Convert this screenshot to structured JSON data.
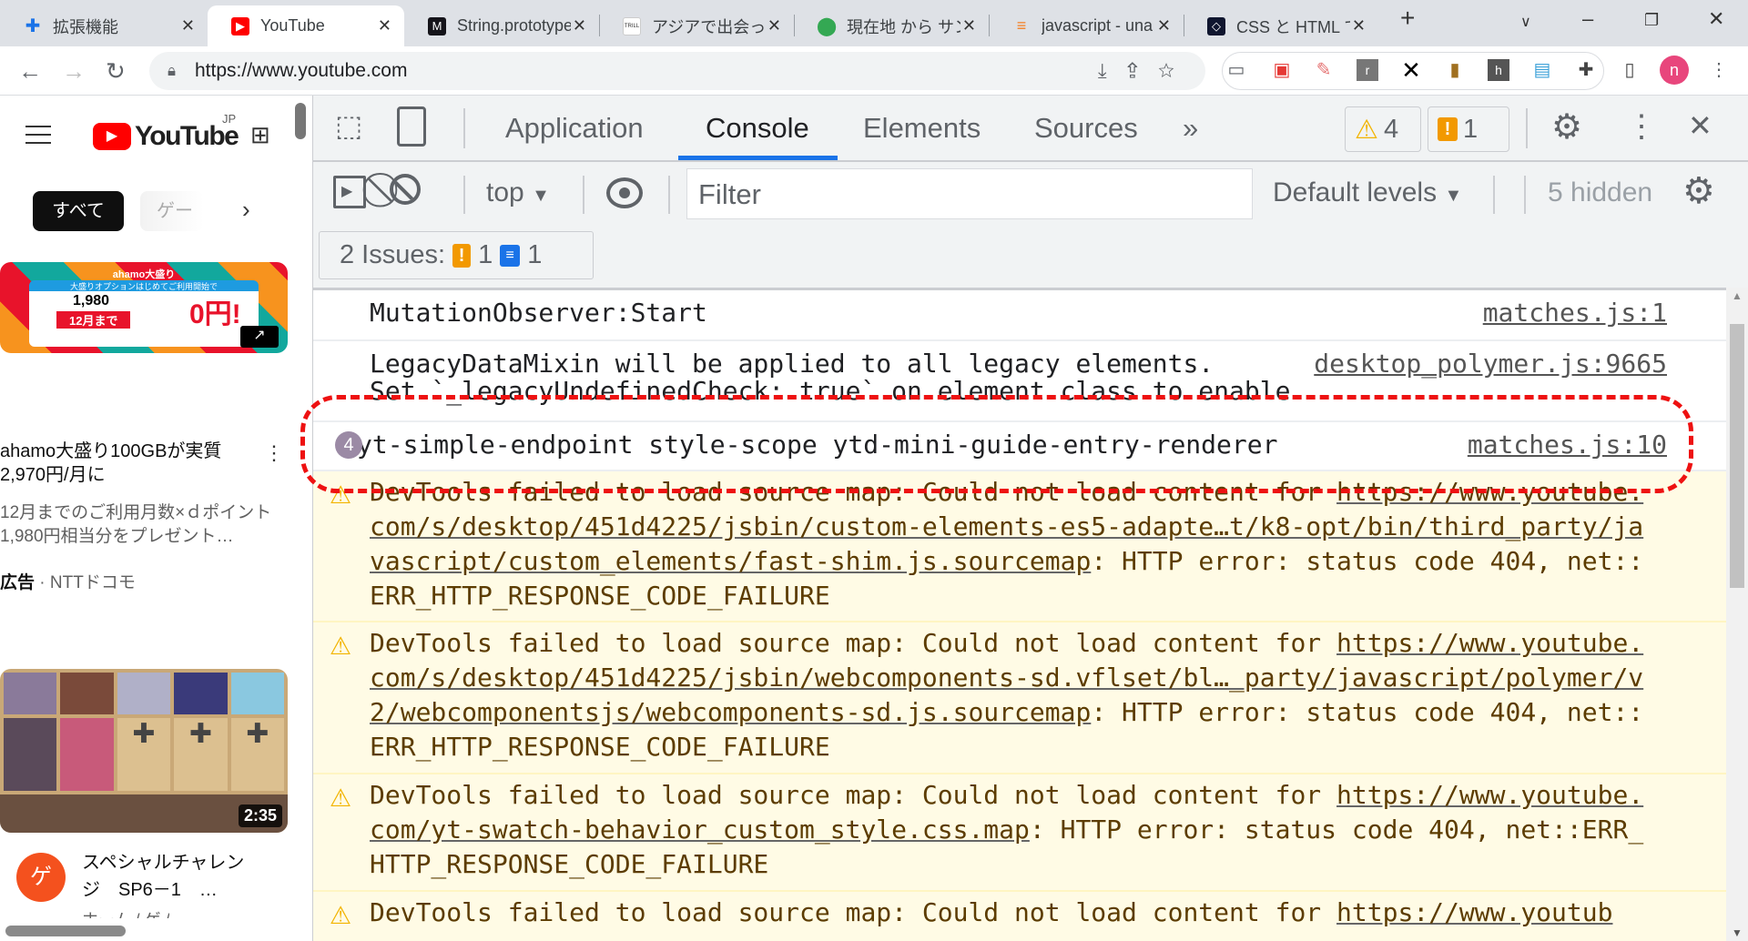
{
  "browser": {
    "tabs": [
      {
        "label": "拡張機能",
        "icon": "puzzle-icon",
        "color": "#1a73e8"
      },
      {
        "label": "YouTube",
        "icon": "youtube-icon",
        "color": "#ff0000"
      },
      {
        "label": "String.prototype",
        "icon": "mdn-icon",
        "color": "#15141a"
      },
      {
        "label": "アジアで出会った",
        "icon": "trill-icon",
        "color": "#ffffff"
      },
      {
        "label": "現在地 から サン",
        "icon": "maps-pin-icon",
        "color": "#34a853"
      },
      {
        "label": "javascript - una",
        "icon": "stackoverflow-icon",
        "color": "#f48024"
      },
      {
        "label": "CSS と HTML で",
        "icon": "codepen-icon",
        "color": "#10162f"
      }
    ],
    "url": "https://www.youtube.com",
    "profile_initial": "n"
  },
  "youtube": {
    "logo": "YouTube",
    "region": "JP",
    "chips": [
      "すべて",
      "ゲー"
    ],
    "ad": {
      "title": "ahamo大盛り100GBが実質2,970円/月に",
      "desc": "12月までのご利用月数×ｄポイント1,980円相当分をプレゼント…",
      "label": "広告",
      "advertiser": "NTTドコモ",
      "banner_text": "ahamo大盛り",
      "banner_line": "大盛りオプションはじめてご利用開始で",
      "banner_price": "1,980",
      "banner_until": "12月まで",
      "banner_zero": "0円!"
    },
    "video": {
      "duration": "2:35",
      "channel_initial": "ゲ",
      "title": "スペシャルチャレンジ　SP6－1　…",
      "sub": "ホーム / ゲ  /"
    }
  },
  "devtools": {
    "tabs": [
      "Application",
      "Console",
      "Elements",
      "Sources"
    ],
    "more": "»",
    "active_tab": "Console",
    "warnings_count": "4",
    "issues_count": "1",
    "context": "top",
    "filter_placeholder": "Filter",
    "levels": "Default levels",
    "hidden": "5 hidden",
    "issues": {
      "label": "2 Issues:",
      "warn": "1",
      "info": "1"
    },
    "messages": [
      {
        "text": "MutationObserver:Start",
        "source": "matches.js:1"
      },
      {
        "text": "LegacyDataMixin will be applied to all legacy elements.",
        "text2": "Set `_legacyUndefinedCheck: true` on element class to enable.",
        "source": "desktop_polymer.js:9665"
      },
      {
        "count": "4",
        "text": "yt-simple-endpoint style-scope ytd-mini-guide-entry-renderer",
        "source": "matches.js:10"
      }
    ],
    "warnings": [
      {
        "prefix": "DevTools failed to load source map: Could not load content for ",
        "url": "https://www.youtube.com/s/desktop/451d4225/jsbin/custom-elements-es5-adapte…t/k8-opt/bin/third_party/javascript/custom_elements/fast-shim.js.sourcemap",
        "suffix": ": HTTP error: status code 404, net::ERR_HTTP_RESPONSE_CODE_FAILURE"
      },
      {
        "prefix": "DevTools failed to load source map: Could not load content for ",
        "url": "https://www.youtube.com/s/desktop/451d4225/jsbin/webcomponents-sd.vflset/bl…_party/javascript/polymer/v2/webcomponentsjs/webcomponents-sd.js.sourcemap",
        "suffix": ": HTTP error: status code 404, net::ERR_HTTP_RESPONSE_CODE_FAILURE"
      },
      {
        "prefix": "DevTools failed to load source map: Could not load content for ",
        "url": "https://www.youtube.com/yt-swatch-behavior_custom_style.css.map",
        "suffix": ": HTTP error: status code 404, net::ERR_HTTP_RESPONSE_CODE_FAILURE"
      },
      {
        "prefix": "DevTools failed to load source map: Could not load content for ",
        "url": "https://www.youtub",
        "suffix": ""
      }
    ]
  }
}
